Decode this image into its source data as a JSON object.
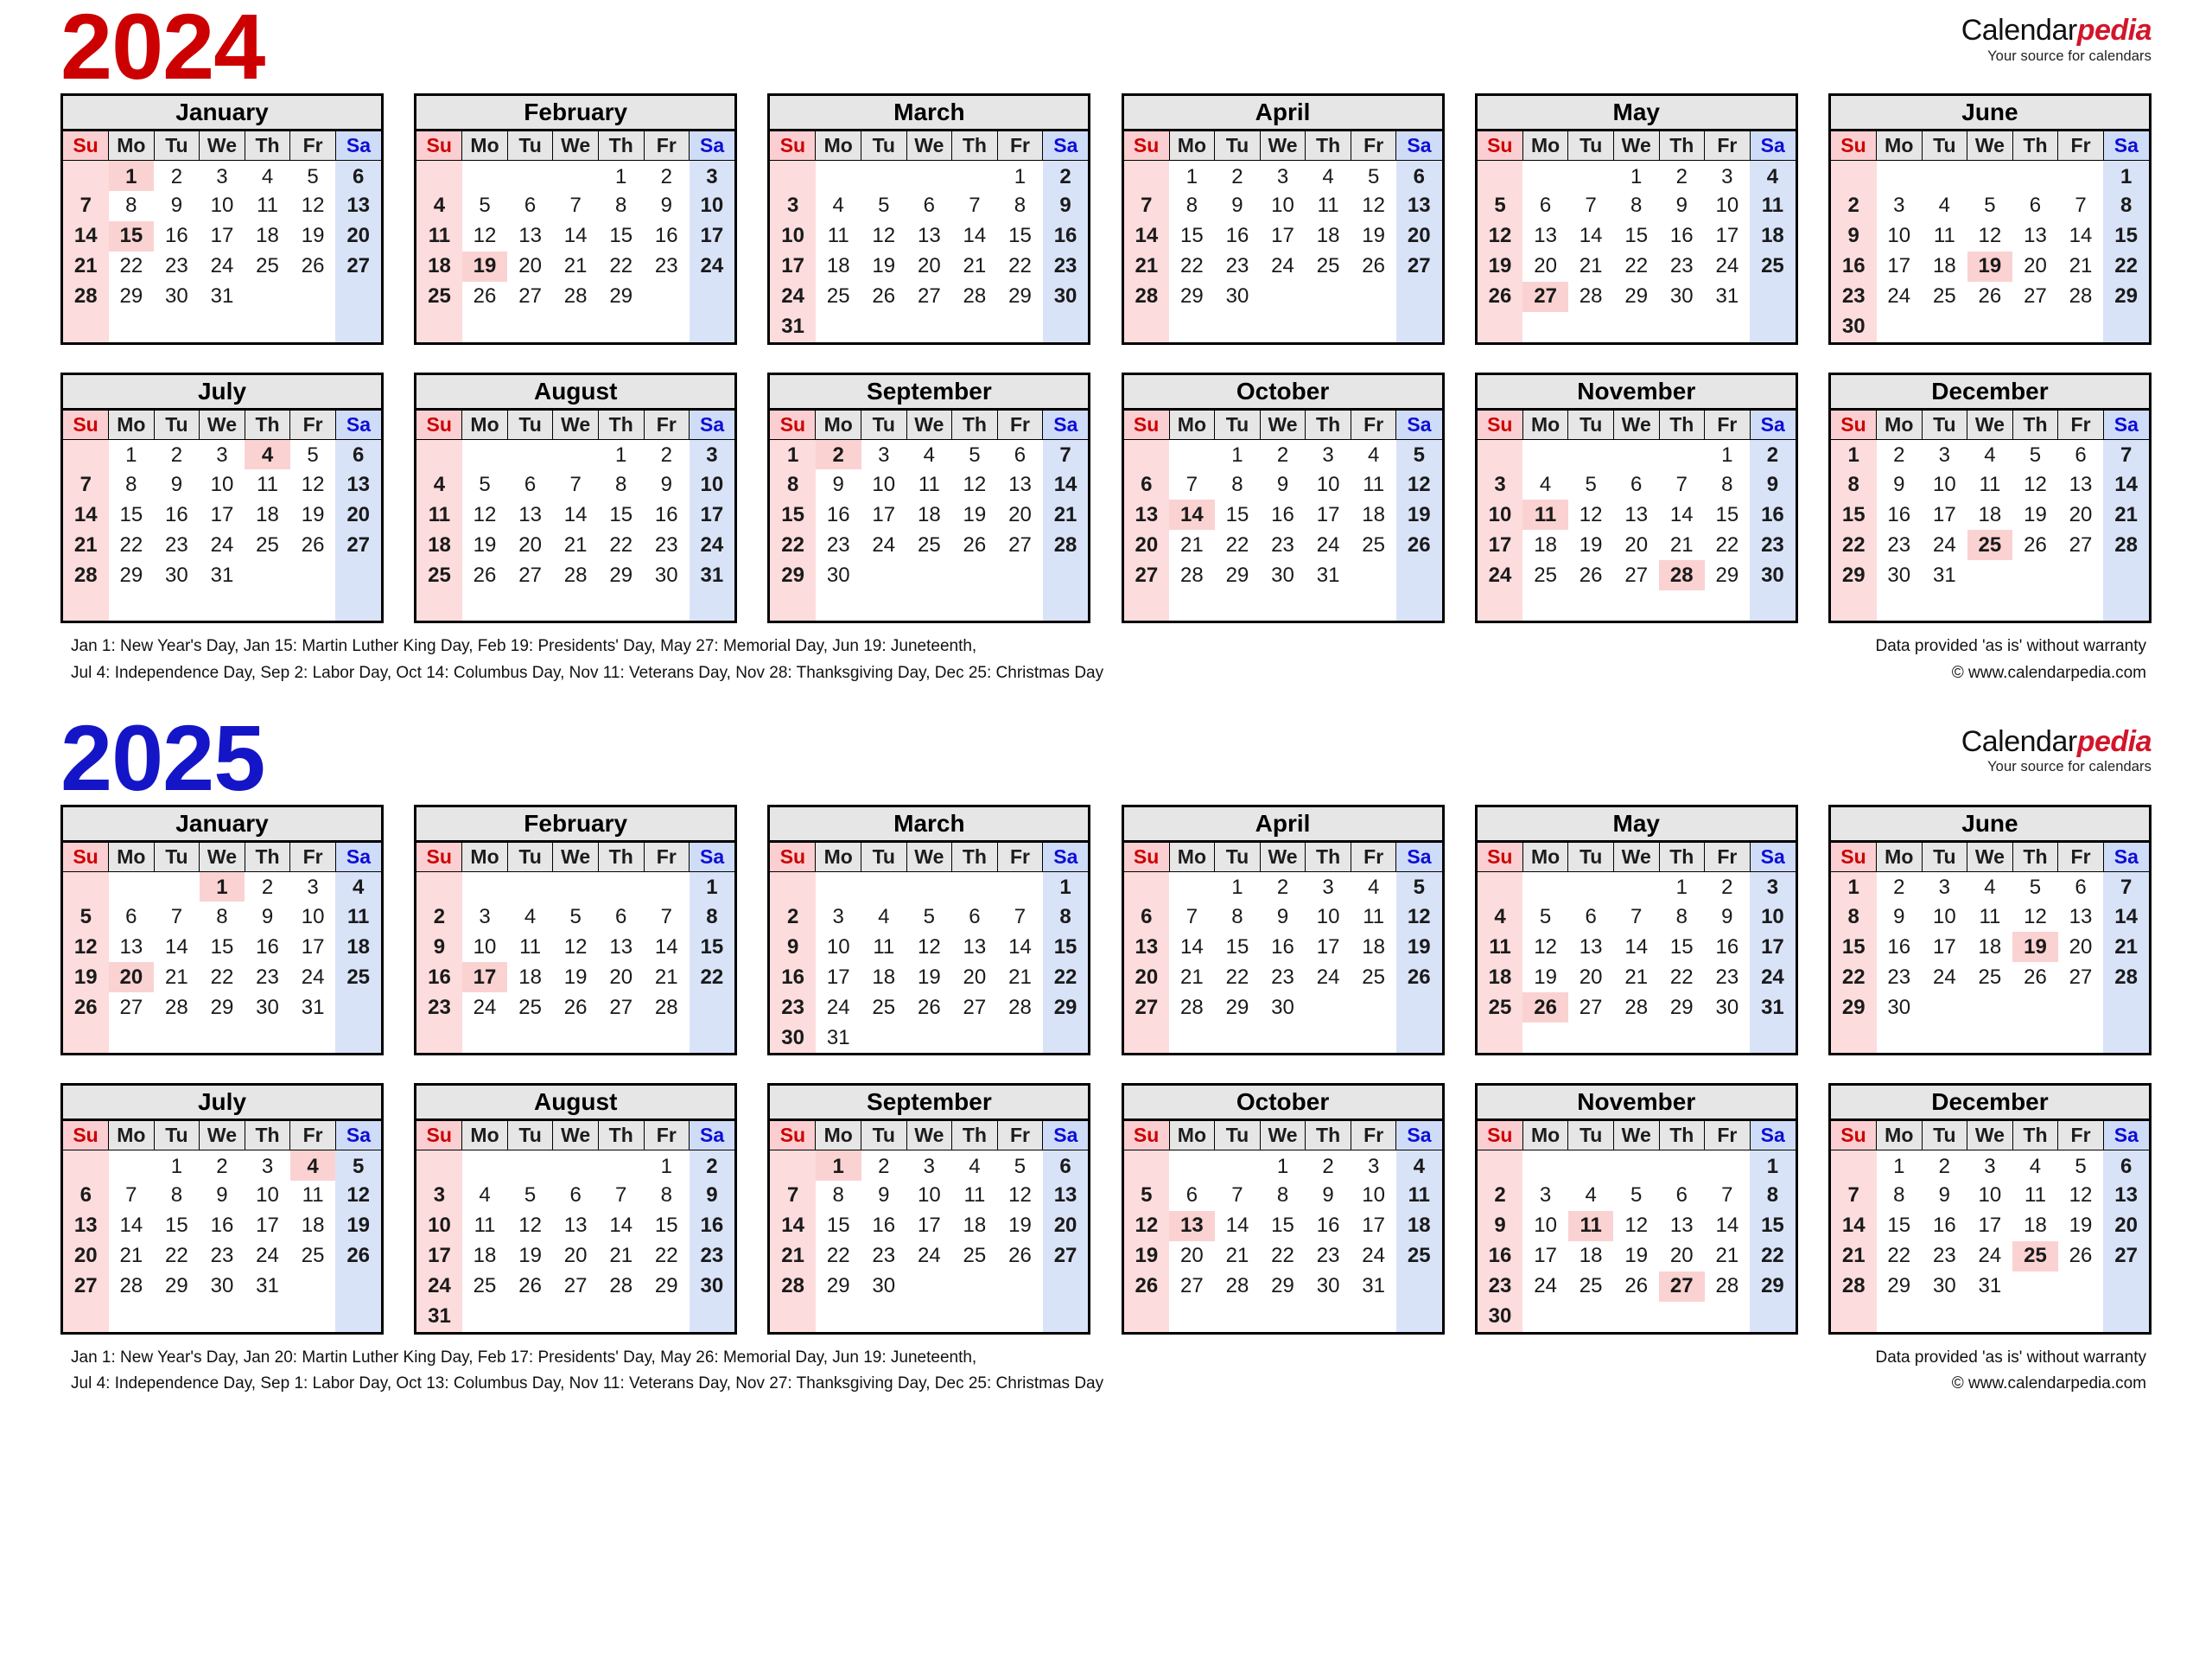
{
  "brand": {
    "name_part1": "Calendar",
    "name_part2": "pedia",
    "tagline": "Your source for calendars",
    "accent_red": "#d3152a"
  },
  "weekday_headers": [
    "Su",
    "Mo",
    "Tu",
    "We",
    "Th",
    "Fr",
    "Sa"
  ],
  "colors": {
    "year_2024": "#cc0000",
    "year_2025": "#1515c8",
    "sunday_bg": "#fcdcdc",
    "saturday_bg": "#d9e3f8",
    "holiday_bg": "#fbd2d2",
    "header_bg": "#e6e6e6",
    "sunday_text": "#cc0000",
    "saturday_text": "#0d0dd6"
  },
  "years": [
    {
      "title": "2024",
      "months": [
        {
          "name": "January",
          "first_weekday": 1,
          "days": 31,
          "holidays": [
            1,
            15
          ]
        },
        {
          "name": "February",
          "first_weekday": 4,
          "days": 29,
          "holidays": [
            19
          ]
        },
        {
          "name": "March",
          "first_weekday": 5,
          "days": 31,
          "holidays": []
        },
        {
          "name": "April",
          "first_weekday": 1,
          "days": 30,
          "holidays": []
        },
        {
          "name": "May",
          "first_weekday": 3,
          "days": 31,
          "holidays": [
            27
          ]
        },
        {
          "name": "June",
          "first_weekday": 6,
          "days": 30,
          "holidays": [
            19
          ]
        },
        {
          "name": "July",
          "first_weekday": 1,
          "days": 31,
          "holidays": [
            4
          ]
        },
        {
          "name": "August",
          "first_weekday": 4,
          "days": 31,
          "holidays": []
        },
        {
          "name": "September",
          "first_weekday": 0,
          "days": 30,
          "holidays": [
            2
          ]
        },
        {
          "name": "October",
          "first_weekday": 2,
          "days": 31,
          "holidays": [
            14
          ]
        },
        {
          "name": "November",
          "first_weekday": 5,
          "days": 30,
          "holidays": [
            11,
            28
          ]
        },
        {
          "name": "December",
          "first_weekday": 0,
          "days": 31,
          "holidays": [
            25
          ]
        }
      ],
      "legend_left": [
        "Jan 1: New Year's Day, Jan 15: Martin Luther King Day, Feb 19: Presidents' Day, May 27: Memorial Day, Jun 19: Juneteenth,",
        "Jul 4: Independence Day, Sep 2: Labor Day, Oct 14: Columbus Day, Nov 11: Veterans Day, Nov 28: Thanksgiving Day, Dec 25: Christmas Day"
      ],
      "legend_right": [
        "Data provided 'as is' without warranty",
        "© www.calendarpedia.com"
      ]
    },
    {
      "title": "2025",
      "months": [
        {
          "name": "January",
          "first_weekday": 3,
          "days": 31,
          "holidays": [
            1,
            20
          ]
        },
        {
          "name": "February",
          "first_weekday": 6,
          "days": 28,
          "holidays": [
            17
          ]
        },
        {
          "name": "March",
          "first_weekday": 6,
          "days": 31,
          "holidays": []
        },
        {
          "name": "April",
          "first_weekday": 2,
          "days": 30,
          "holidays": []
        },
        {
          "name": "May",
          "first_weekday": 4,
          "days": 31,
          "holidays": [
            26
          ]
        },
        {
          "name": "June",
          "first_weekday": 0,
          "days": 30,
          "holidays": [
            19
          ]
        },
        {
          "name": "July",
          "first_weekday": 2,
          "days": 31,
          "holidays": [
            4
          ]
        },
        {
          "name": "August",
          "first_weekday": 5,
          "days": 31,
          "holidays": []
        },
        {
          "name": "September",
          "first_weekday": 1,
          "days": 30,
          "holidays": [
            1
          ]
        },
        {
          "name": "October",
          "first_weekday": 3,
          "days": 31,
          "holidays": [
            13
          ]
        },
        {
          "name": "November",
          "first_weekday": 6,
          "days": 30,
          "holidays": [
            11,
            27
          ]
        },
        {
          "name": "December",
          "first_weekday": 1,
          "days": 31,
          "holidays": [
            25
          ]
        }
      ],
      "legend_left": [
        "Jan 1: New Year's Day, Jan 20: Martin Luther King Day, Feb 17: Presidents' Day, May 26: Memorial Day, Jun 19: Juneteenth,",
        "Jul 4: Independence Day, Sep 1: Labor Day, Oct 13: Columbus Day, Nov 11: Veterans Day, Nov 27: Thanksgiving Day, Dec 25: Christmas Day"
      ],
      "legend_right": [
        "Data provided 'as is' without warranty",
        "© www.calendarpedia.com"
      ]
    }
  ]
}
